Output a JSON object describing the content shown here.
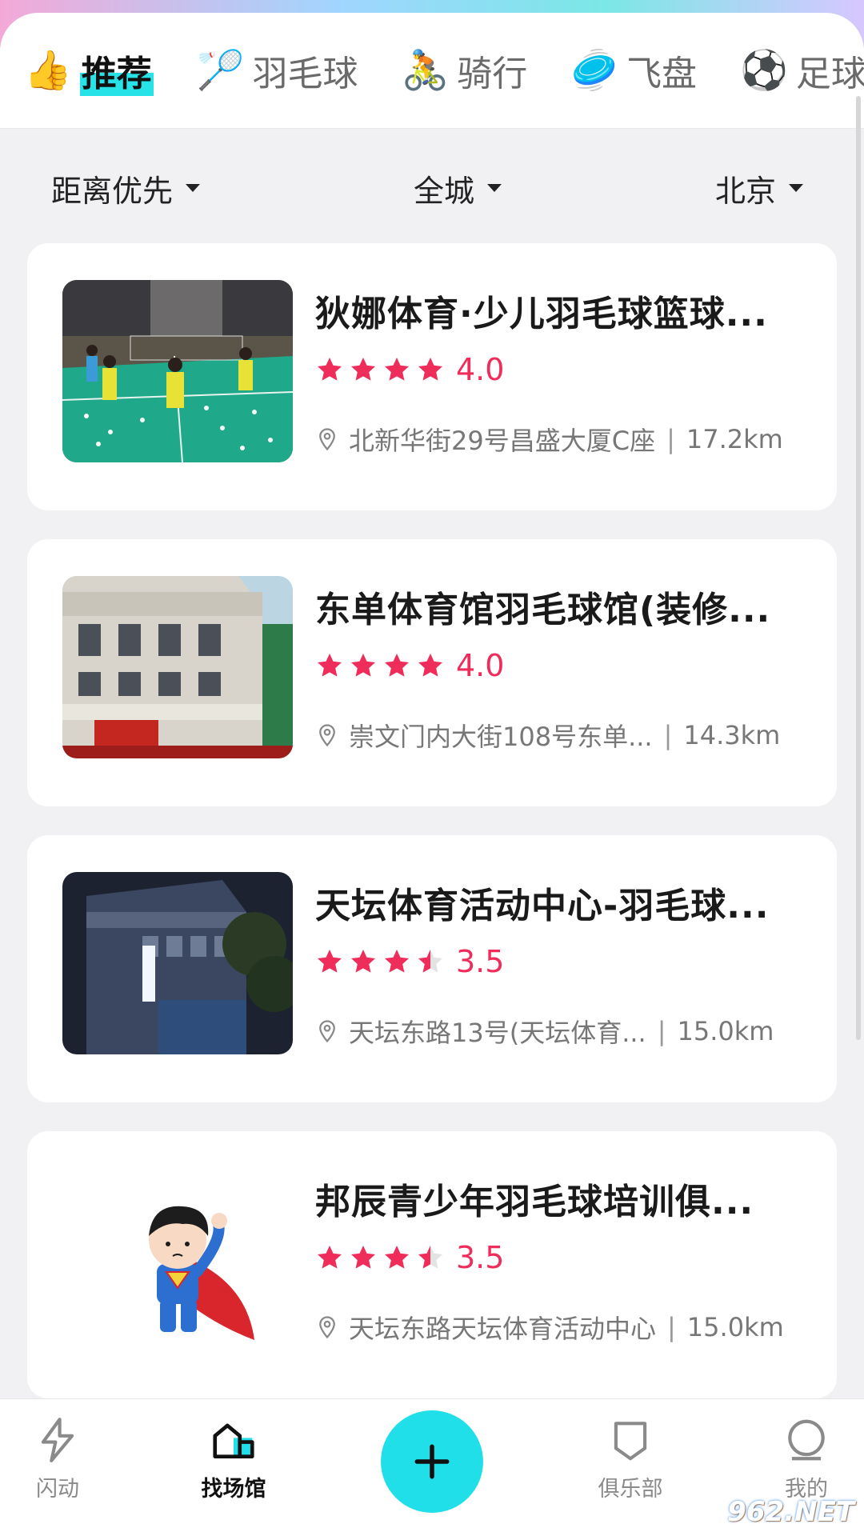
{
  "tabs": [
    {
      "emoji": "👍",
      "label": "推荐",
      "active": true
    },
    {
      "emoji": "🏸",
      "label": "羽毛球",
      "active": false
    },
    {
      "emoji": "🚴",
      "label": "骑行",
      "active": false
    },
    {
      "emoji": "🥏",
      "label": "飞盘",
      "active": false
    },
    {
      "emoji": "⚽",
      "label": "足球",
      "active": false
    }
  ],
  "filters": {
    "sort": "距离优先",
    "area": "全城",
    "city": "北京"
  },
  "venues": [
    {
      "name": "狄娜体育·少儿羽毛球篮球...",
      "rating": "4.0",
      "stars": 4,
      "address": "北新华街29号昌盛大厦C座",
      "distance": "17.2km",
      "image": "badminton-hall-photo"
    },
    {
      "name": "东单体育馆羽毛球馆(装修...",
      "rating": "4.0",
      "stars": 4,
      "address": "崇文门内大街108号东单...",
      "distance": "14.3km",
      "image": "sports-building-photo"
    },
    {
      "name": "天坛体育活动中心-羽毛球...",
      "rating": "3.5",
      "stars": 3.5,
      "address": "天坛东路13号(天坛体育...",
      "distance": "15.0km",
      "image": "night-building-photo"
    },
    {
      "name": "邦辰青少年羽毛球培训俱...",
      "rating": "3.5",
      "stars": 3.5,
      "address": "天坛东路天坛体育活动中心",
      "distance": "15.0km",
      "image": "cartoon-superhero"
    }
  ],
  "nav": {
    "flash": "闪动",
    "venues": "找场馆",
    "club": "俱乐部",
    "mine": "我的"
  },
  "watermark": "962.NET",
  "colors": {
    "accent": "#21dfe8",
    "star": "#ee2d5a"
  }
}
